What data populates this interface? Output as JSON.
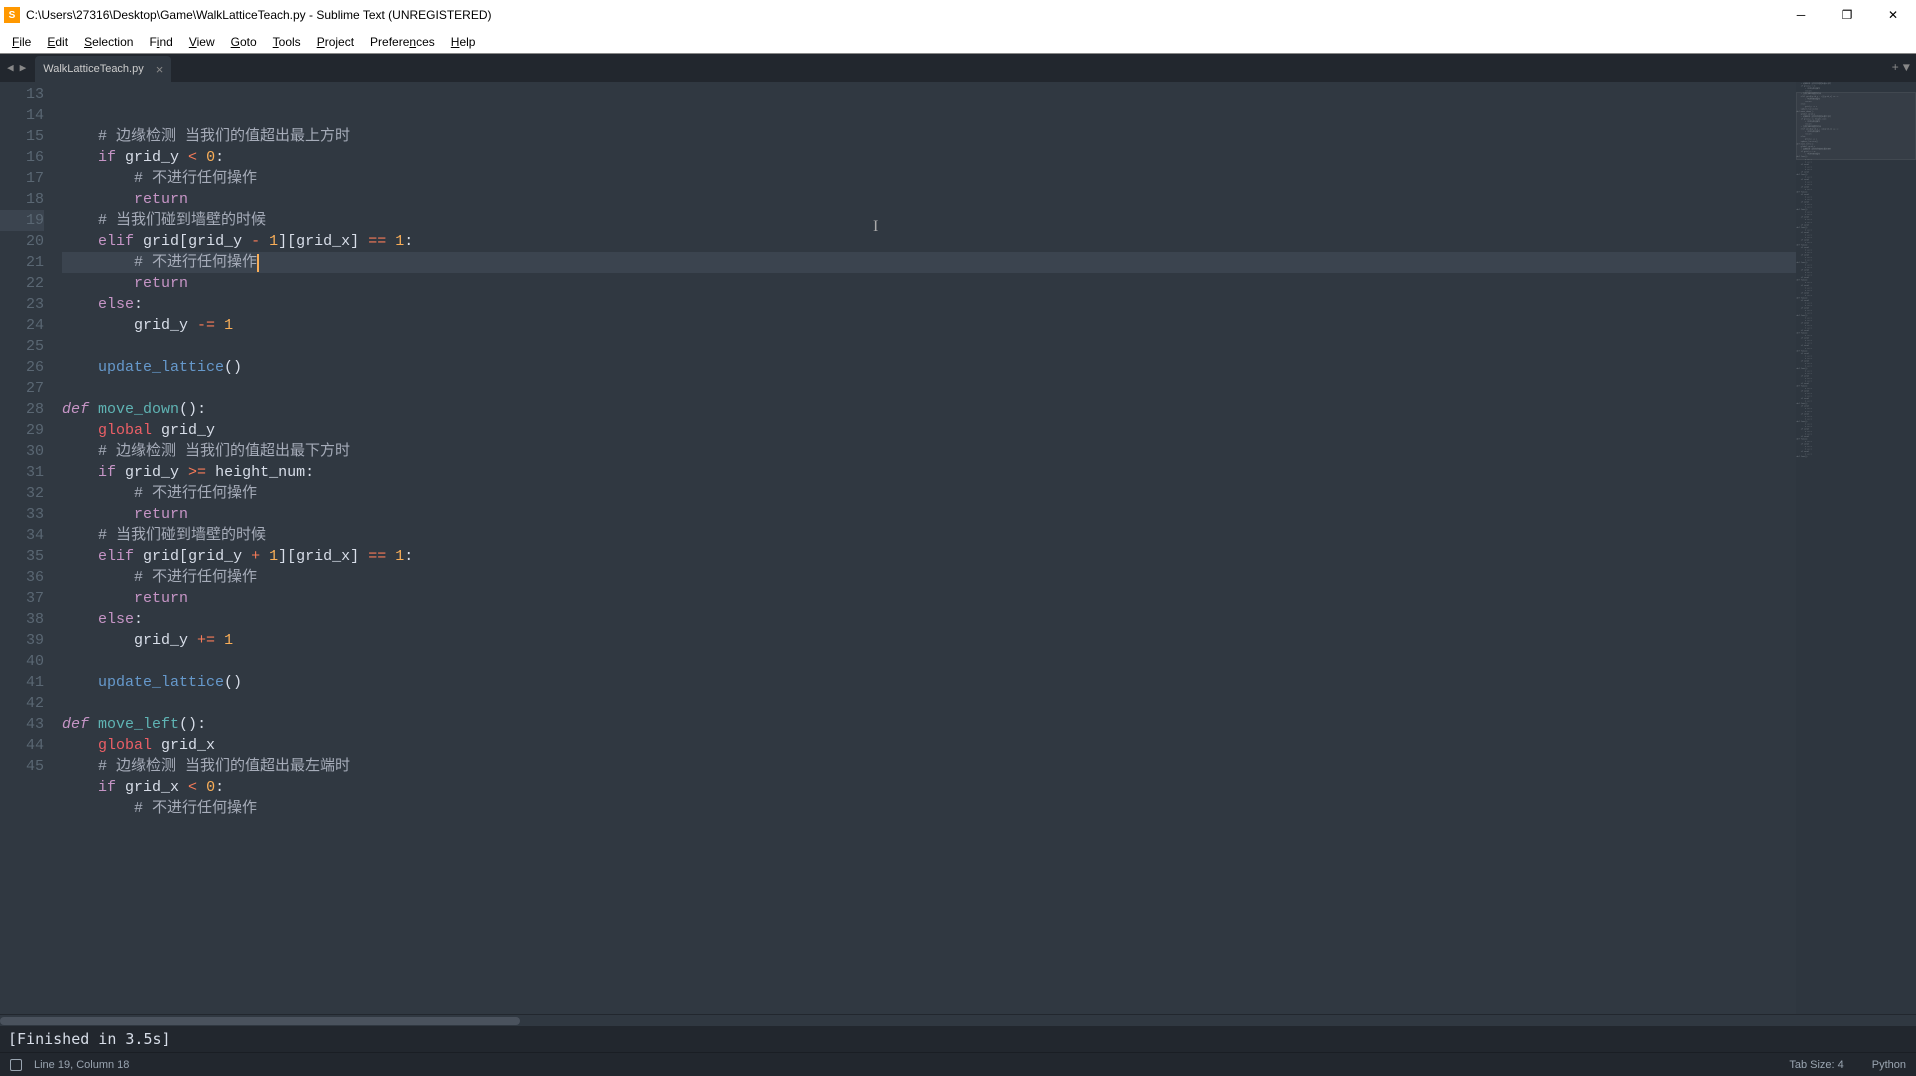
{
  "titlebar": {
    "title": "C:\\Users\\27316\\Desktop\\Game\\WalkLatticeTeach.py - Sublime Text (UNREGISTERED)"
  },
  "menubar": {
    "items": [
      "File",
      "Edit",
      "Selection",
      "Find",
      "View",
      "Goto",
      "Tools",
      "Project",
      "Preferences",
      "Help"
    ]
  },
  "tabs": {
    "active": "WalkLatticeTeach.py"
  },
  "code": {
    "first_line_number": 13,
    "current_line_number": 19,
    "cursor_col": 18,
    "lines": [
      {
        "n": 13,
        "t": [
          [
            "id",
            "    "
          ],
          [
            "cm",
            "#"
          ],
          [
            "id",
            " "
          ],
          [
            "cm",
            "边缘检测 当我们的值超出最上方时"
          ]
        ]
      },
      {
        "n": 14,
        "t": [
          [
            "id",
            "    "
          ],
          [
            "kw2",
            "if"
          ],
          [
            "id",
            " grid_y "
          ],
          [
            "op",
            "<"
          ],
          [
            "id",
            " "
          ],
          [
            "num",
            "0"
          ],
          [
            "id",
            ":"
          ]
        ]
      },
      {
        "n": 15,
        "t": [
          [
            "id",
            "        "
          ],
          [
            "cm",
            "#"
          ],
          [
            "id",
            " "
          ],
          [
            "cm",
            "不进行任何操作"
          ]
        ]
      },
      {
        "n": 16,
        "t": [
          [
            "id",
            "        "
          ],
          [
            "kw2",
            "return"
          ]
        ]
      },
      {
        "n": 17,
        "t": [
          [
            "id",
            "    "
          ],
          [
            "cm",
            "#"
          ],
          [
            "id",
            " "
          ],
          [
            "cm",
            "当我们碰到墙壁的时候"
          ]
        ]
      },
      {
        "n": 18,
        "t": [
          [
            "id",
            "    "
          ],
          [
            "kw2",
            "elif"
          ],
          [
            "id",
            " grid"
          ],
          [
            "paren",
            "["
          ],
          [
            "id",
            "grid_y "
          ],
          [
            "op",
            "-"
          ],
          [
            "id",
            " "
          ],
          [
            "num",
            "1"
          ],
          [
            "paren",
            "]["
          ],
          [
            "id",
            "grid_x"
          ],
          [
            "paren",
            "]"
          ],
          [
            "id",
            " "
          ],
          [
            "op",
            "=="
          ],
          [
            "id",
            " "
          ],
          [
            "num",
            "1"
          ],
          [
            "id",
            ":"
          ]
        ]
      },
      {
        "n": 19,
        "t": [
          [
            "id",
            "        "
          ],
          [
            "cm",
            "#"
          ],
          [
            "id",
            " "
          ],
          [
            "cm",
            "不进行任何操作"
          ]
        ],
        "cursor": true
      },
      {
        "n": 20,
        "t": [
          [
            "id",
            "        "
          ],
          [
            "kw2",
            "return"
          ]
        ]
      },
      {
        "n": 21,
        "t": [
          [
            "id",
            "    "
          ],
          [
            "kw2",
            "else"
          ],
          [
            "id",
            ":"
          ]
        ]
      },
      {
        "n": 22,
        "t": [
          [
            "id",
            "        grid_y "
          ],
          [
            "op",
            "-="
          ],
          [
            "id",
            " "
          ],
          [
            "num",
            "1"
          ]
        ]
      },
      {
        "n": 23,
        "t": [
          [
            "id",
            ""
          ]
        ]
      },
      {
        "n": 24,
        "t": [
          [
            "id",
            "    "
          ],
          [
            "fncall",
            "update_lattice"
          ],
          [
            "paren",
            "()"
          ]
        ]
      },
      {
        "n": 25,
        "t": [
          [
            "id",
            ""
          ]
        ]
      },
      {
        "n": 26,
        "t": [
          [
            "kw",
            "def"
          ],
          [
            "id",
            " "
          ],
          [
            "fn",
            "move_down"
          ],
          [
            "paren",
            "()"
          ],
          [
            "id",
            ":"
          ]
        ]
      },
      {
        "n": 27,
        "t": [
          [
            "id",
            "    "
          ],
          [
            "st",
            "global"
          ],
          [
            "id",
            " grid_y"
          ]
        ]
      },
      {
        "n": 28,
        "t": [
          [
            "id",
            "    "
          ],
          [
            "cm",
            "#"
          ],
          [
            "id",
            " "
          ],
          [
            "cm",
            "边缘检测 当我们的值超出最下方时"
          ]
        ]
      },
      {
        "n": 29,
        "t": [
          [
            "id",
            "    "
          ],
          [
            "kw2",
            "if"
          ],
          [
            "id",
            " grid_y "
          ],
          [
            "op",
            ">="
          ],
          [
            "id",
            " height_num:"
          ]
        ]
      },
      {
        "n": 30,
        "t": [
          [
            "id",
            "        "
          ],
          [
            "cm",
            "#"
          ],
          [
            "id",
            " "
          ],
          [
            "cm",
            "不进行任何操作"
          ]
        ]
      },
      {
        "n": 31,
        "t": [
          [
            "id",
            "        "
          ],
          [
            "kw2",
            "return"
          ]
        ]
      },
      {
        "n": 32,
        "t": [
          [
            "id",
            "    "
          ],
          [
            "cm",
            "#"
          ],
          [
            "id",
            " "
          ],
          [
            "cm",
            "当我们碰到墙壁的时候"
          ]
        ]
      },
      {
        "n": 33,
        "t": [
          [
            "id",
            "    "
          ],
          [
            "kw2",
            "elif"
          ],
          [
            "id",
            " grid"
          ],
          [
            "paren",
            "["
          ],
          [
            "id",
            "grid_y "
          ],
          [
            "op",
            "+"
          ],
          [
            "id",
            " "
          ],
          [
            "num",
            "1"
          ],
          [
            "paren",
            "]["
          ],
          [
            "id",
            "grid_x"
          ],
          [
            "paren",
            "]"
          ],
          [
            "id",
            " "
          ],
          [
            "op",
            "=="
          ],
          [
            "id",
            " "
          ],
          [
            "num",
            "1"
          ],
          [
            "id",
            ":"
          ]
        ]
      },
      {
        "n": 34,
        "t": [
          [
            "id",
            "        "
          ],
          [
            "cm",
            "#"
          ],
          [
            "id",
            " "
          ],
          [
            "cm",
            "不进行任何操作"
          ]
        ]
      },
      {
        "n": 35,
        "t": [
          [
            "id",
            "        "
          ],
          [
            "kw2",
            "return"
          ]
        ]
      },
      {
        "n": 36,
        "t": [
          [
            "id",
            "    "
          ],
          [
            "kw2",
            "else"
          ],
          [
            "id",
            ":"
          ]
        ]
      },
      {
        "n": 37,
        "t": [
          [
            "id",
            "        grid_y "
          ],
          [
            "op",
            "+="
          ],
          [
            "id",
            " "
          ],
          [
            "num",
            "1"
          ]
        ]
      },
      {
        "n": 38,
        "t": [
          [
            "id",
            ""
          ]
        ]
      },
      {
        "n": 39,
        "t": [
          [
            "id",
            "    "
          ],
          [
            "fncall",
            "update_lattice"
          ],
          [
            "paren",
            "()"
          ]
        ]
      },
      {
        "n": 40,
        "t": [
          [
            "id",
            ""
          ]
        ]
      },
      {
        "n": 41,
        "t": [
          [
            "kw",
            "def"
          ],
          [
            "id",
            " "
          ],
          [
            "fn",
            "move_left"
          ],
          [
            "paren",
            "()"
          ],
          [
            "id",
            ":"
          ]
        ]
      },
      {
        "n": 42,
        "t": [
          [
            "id",
            "    "
          ],
          [
            "st",
            "global"
          ],
          [
            "id",
            " grid_x"
          ]
        ]
      },
      {
        "n": 43,
        "t": [
          [
            "id",
            "    "
          ],
          [
            "cm",
            "#"
          ],
          [
            "id",
            " "
          ],
          [
            "cm",
            "边缘检测 当我们的值超出最左端时"
          ]
        ]
      },
      {
        "n": 44,
        "t": [
          [
            "id",
            "    "
          ],
          [
            "kw2",
            "if"
          ],
          [
            "id",
            " grid_x "
          ],
          [
            "op",
            "<"
          ],
          [
            "id",
            " "
          ],
          [
            "num",
            "0"
          ],
          [
            "id",
            ":"
          ]
        ]
      },
      {
        "n": 45,
        "t": [
          [
            "id",
            "        "
          ],
          [
            "cm",
            "#"
          ],
          [
            "id",
            " "
          ],
          [
            "cm",
            "不进行任何操作"
          ]
        ]
      }
    ]
  },
  "console": {
    "output": "[Finished in 3.5s]"
  },
  "statusbar": {
    "position": "Line 19, Column 18",
    "tab_size": "Tab Size: 4",
    "syntax": "Python"
  }
}
